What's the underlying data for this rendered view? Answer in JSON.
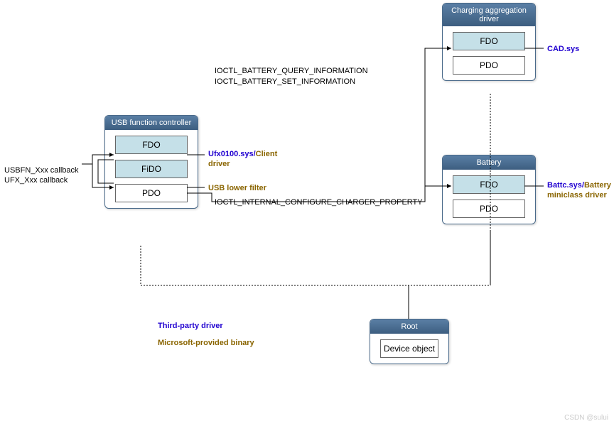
{
  "boxes": {
    "charging_agg": {
      "title": "Charging aggregation driver",
      "fdo": "FDO",
      "pdo": "PDO"
    },
    "battery": {
      "title": "Battery",
      "fdo": "FDO",
      "pdo": "PDO"
    },
    "usb_fc": {
      "title": "USB function controller",
      "fdo": "FDO",
      "fido": "FiDO",
      "pdo": "PDO"
    },
    "root": {
      "title": "Root",
      "device_obj": "Device object"
    }
  },
  "labels": {
    "cad_sys": "CAD.sys",
    "battc_sys": "Battc.sys/",
    "miniclass": "Battery miniclass driver",
    "ufx": "Ufx0100.sys/",
    "client_driver": "Client driver",
    "usb_lower_filter": "USB lower filter",
    "ioctl_query": "IOCTL_BATTERY_QUERY_INFORMATION",
    "ioctl_set": "IOCTL_BATTERY_SET_INFORMATION",
    "ioctl_charger": "IOCTL_INTERNAL_CONFIGURE_CHARGER_PROPERTY",
    "usbfn_callback": "USBFN_Xxx callback",
    "ufx_callback": "UFX_Xxx callback",
    "third_party": "Third-party driver",
    "ms_provided": "Microsoft-provided binary"
  },
  "watermark": "CSDN @sului"
}
